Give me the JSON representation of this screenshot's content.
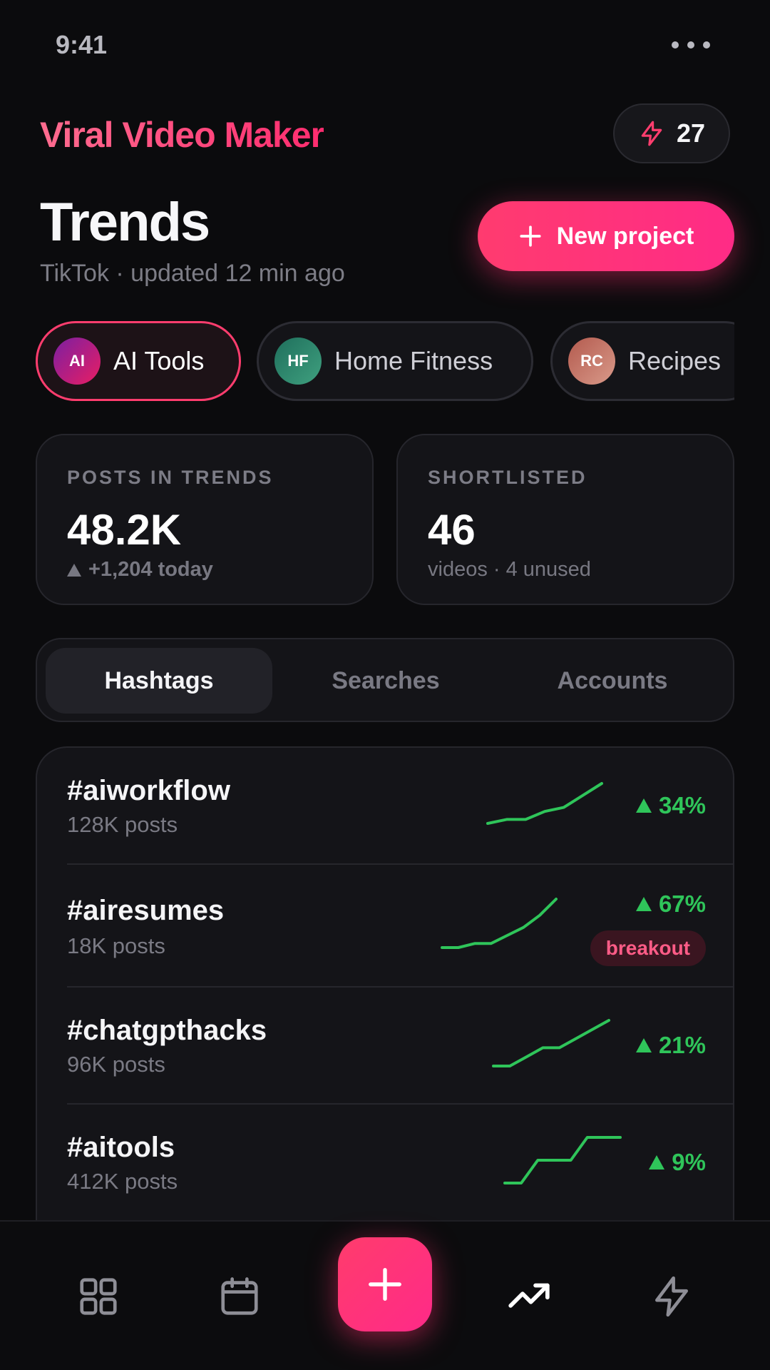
{
  "status_bar": {
    "time": "9:41"
  },
  "header": {
    "app_title": "Viral Video Maker",
    "energy_count": "27",
    "page_title": "Trends",
    "subtitle": "TikTok · updated 12 min ago",
    "new_project_label": "New project"
  },
  "topics": [
    {
      "initials": "AI",
      "label": "AI Tools",
      "active": true
    },
    {
      "initials": "HF",
      "label": "Home Fitness",
      "active": false
    },
    {
      "initials": "RC",
      "label": "Recipes",
      "active": false
    }
  ],
  "stats": {
    "posts": {
      "label": "POSTS IN TRENDS",
      "value": "48.2K",
      "note": "+1,204 today"
    },
    "shortlisted": {
      "label": "SHORTLISTED",
      "value": "46",
      "note": "videos · 4 unused"
    }
  },
  "tabs": [
    {
      "label": "Hashtags",
      "active": true
    },
    {
      "label": "Searches",
      "active": false
    },
    {
      "label": "Accounts",
      "active": false
    }
  ],
  "hashtags": [
    {
      "tag": "#aiworkflow",
      "posts": "128K posts",
      "change": "34%",
      "trend": [
        2,
        3,
        3,
        5,
        6,
        9,
        12
      ]
    },
    {
      "tag": "#airesumes",
      "posts": "18K posts",
      "change": "67%",
      "badge": "breakout",
      "trend": [
        2,
        2,
        3,
        3,
        5,
        7,
        10,
        14
      ]
    },
    {
      "tag": "#chatgpthacks",
      "posts": "96K posts",
      "change": "21%",
      "trend": [
        2,
        2,
        5,
        8,
        8,
        11,
        14,
        17
      ]
    },
    {
      "tag": "#aitools",
      "posts": "412K posts",
      "change": "9%",
      "trend": [
        2,
        2,
        6,
        6,
        6,
        10,
        10,
        10
      ]
    }
  ],
  "colors": {
    "accent": "#ff2d6f",
    "positive": "#2fc55a",
    "background": "#0b0b0d",
    "card": "#141418"
  },
  "nav": {
    "items": [
      {
        "icon": "grid-icon",
        "active": false
      },
      {
        "icon": "calendar-icon",
        "active": false
      },
      {
        "icon": "plus-icon",
        "active": true
      },
      {
        "icon": "trending-icon",
        "active": true
      },
      {
        "icon": "bolt-icon",
        "active": false
      }
    ]
  }
}
